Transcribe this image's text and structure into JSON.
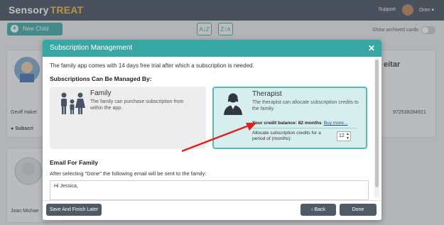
{
  "app": {
    "logo_part1": "Sensory",
    "logo_part2": "TREAT",
    "support": "Support",
    "user": "Oren ▾"
  },
  "toolbar": {
    "new_child": "New Child",
    "sort_az": "A↓Z",
    "sort_za": "Z↑A",
    "show_archived": "Show archived cards"
  },
  "background_cards": {
    "card1_name": "Geoff Hakel",
    "card1_status": "Subscri",
    "card2_name": "Joan Michae",
    "card3_title": "eitar",
    "card3_phone": "972538284921"
  },
  "modal": {
    "title": "Subscription Management",
    "close": "✕",
    "intro": "The family app comes with 14 days free trial after which a subscription is needed.",
    "managed_heading": "Subscriptions Can Be Managed By:",
    "family": {
      "title": "Family",
      "desc": "The family can purchase subscription from within the app."
    },
    "therapist": {
      "title": "Therapist",
      "desc": "The therapist can allocate subscription credits to the family.",
      "credit": "Your credit balance: 82 months",
      "buy_more": "Buy more...",
      "allocate": "Allocate subscription credits for a period of (months):",
      "months": "12"
    },
    "email_heading": "Email For Family",
    "email_note": "After selecting \"Done\" the following email will be sent to the family:",
    "email_body": "Hi Jessica,",
    "save_later": "Save And Finish Later",
    "back": "‹ Back",
    "done": "Done"
  },
  "colors": {
    "accent": "#38a7a4",
    "topbar": "#3f4b59",
    "arrow": "#e0201b"
  }
}
